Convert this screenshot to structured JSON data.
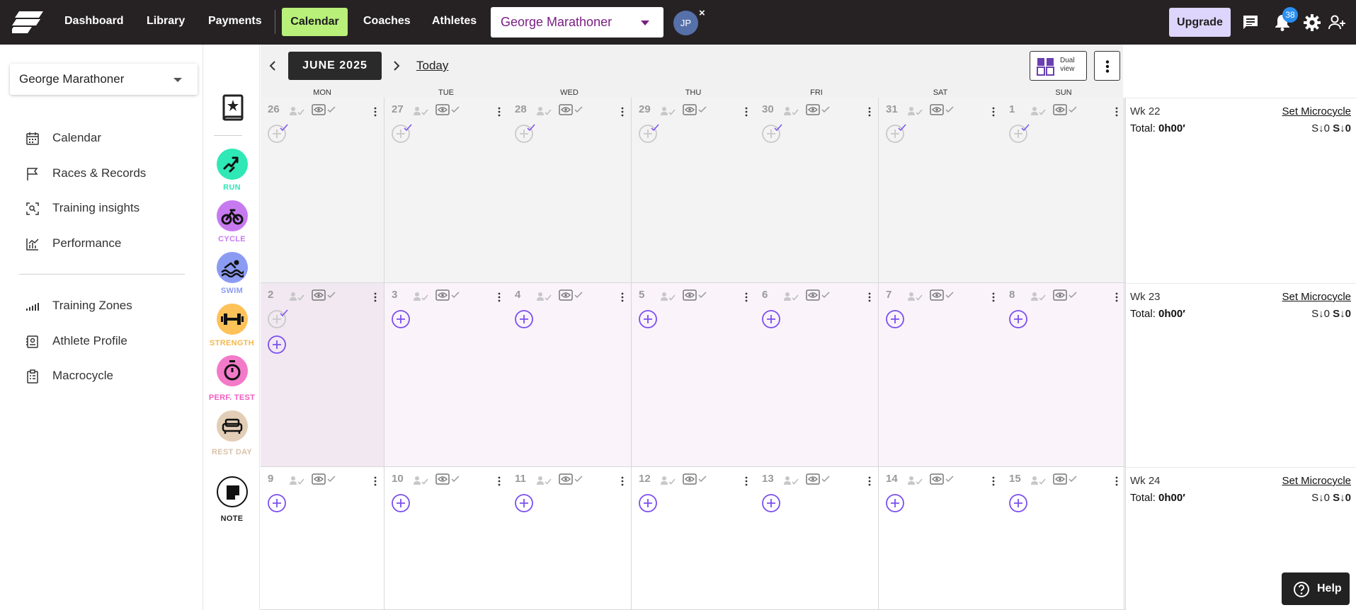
{
  "nav": {
    "links": [
      "Dashboard",
      "Library",
      "Payments"
    ],
    "calendar": "Calendar",
    "links2": [
      "Coaches",
      "Athletes"
    ],
    "athlete_select": "George Marathoner",
    "avatar_initials": "JP",
    "avatar_close": "×",
    "upgrade": "Upgrade",
    "notification_count": "38",
    "colors": {
      "bar": "#262223",
      "calendar_active": "#b8f07a",
      "athlete_text": "#7a1f83",
      "upgrade_bg": "#ddd5fb",
      "badge": "#2a8ef0"
    }
  },
  "sidebar": {
    "athlete_select": "George Marathoner",
    "items": [
      {
        "label": "Calendar",
        "icon": "calendar-icon"
      },
      {
        "label": "Races & Records",
        "icon": "flag-icon"
      },
      {
        "label": "Training insights",
        "icon": "scan-icon"
      },
      {
        "label": "Performance",
        "icon": "chart-icon"
      },
      {
        "label": "Training Zones",
        "icon": "zones-icon"
      },
      {
        "label": "Athlete Profile",
        "icon": "profile-icon"
      },
      {
        "label": "Macrocycle",
        "icon": "clipboard-icon"
      }
    ]
  },
  "palette": [
    {
      "label": "RUN",
      "color": "#2ee8b6",
      "text_color": "#2ee8b6",
      "icon": "run-icon"
    },
    {
      "label": "CYCLE",
      "color": "#c77af0",
      "text_color": "#c77af0",
      "icon": "cycle-icon"
    },
    {
      "label": "SWIM",
      "color": "#8c9bf2",
      "text_color": "#8c9bf2",
      "icon": "swim-icon"
    },
    {
      "label": "STRENGTH",
      "color": "#ffc259",
      "text_color": "#f4b84c",
      "icon": "strength-icon"
    },
    {
      "label": "PERF. TEST",
      "color": "#f27ac8",
      "text_color": "#f05bbd",
      "icon": "stopwatch-icon"
    },
    {
      "label": "REST DAY",
      "color": "#e2cdb6",
      "text_color": "#d8c2a9",
      "icon": "sofa-icon"
    },
    {
      "label": "NOTE",
      "color": "#ffffff",
      "text_color": "#222222",
      "icon": "note-icon"
    }
  ],
  "calendar": {
    "month_label": "JUNE 2025",
    "today_label": "Today",
    "dual_view": [
      "Dual",
      "view"
    ],
    "days": [
      "MON",
      "TUE",
      "WED",
      "THU",
      "FRI",
      "SAT",
      "SUN"
    ],
    "weeks": [
      {
        "dates": [
          "26",
          "27",
          "28",
          "29",
          "30",
          "31",
          "1"
        ],
        "state": "past",
        "week_label": "Wk 22",
        "total_label": "Total:",
        "total_value": "0h00′",
        "set_microcycle": "Set Microcycle",
        "stress_a": "S↓0",
        "stress_b": "S↓0"
      },
      {
        "dates": [
          "2",
          "3",
          "4",
          "5",
          "6",
          "7",
          "8"
        ],
        "state": "current",
        "week_label": "Wk 23",
        "total_label": "Total:",
        "total_value": "0h00′",
        "set_microcycle": "Set Microcycle",
        "stress_a": "S↓0",
        "stress_b": "S↓0"
      },
      {
        "dates": [
          "9",
          "10",
          "11",
          "12",
          "13",
          "14",
          "15"
        ],
        "state": "future",
        "week_label": "Wk 24",
        "total_label": "Total:",
        "total_value": "0h00′",
        "set_microcycle": "Set Microcycle",
        "stress_a": "S↓0",
        "stress_b": "S↓0"
      }
    ],
    "colors": {
      "past_bg": "#f3f3f3",
      "current_bg": "#faf3fa",
      "today_bg": "#f1e8f1",
      "future_bg": "#ffffff",
      "add_icon": "#7b4ff0"
    }
  },
  "help_label": "Help"
}
